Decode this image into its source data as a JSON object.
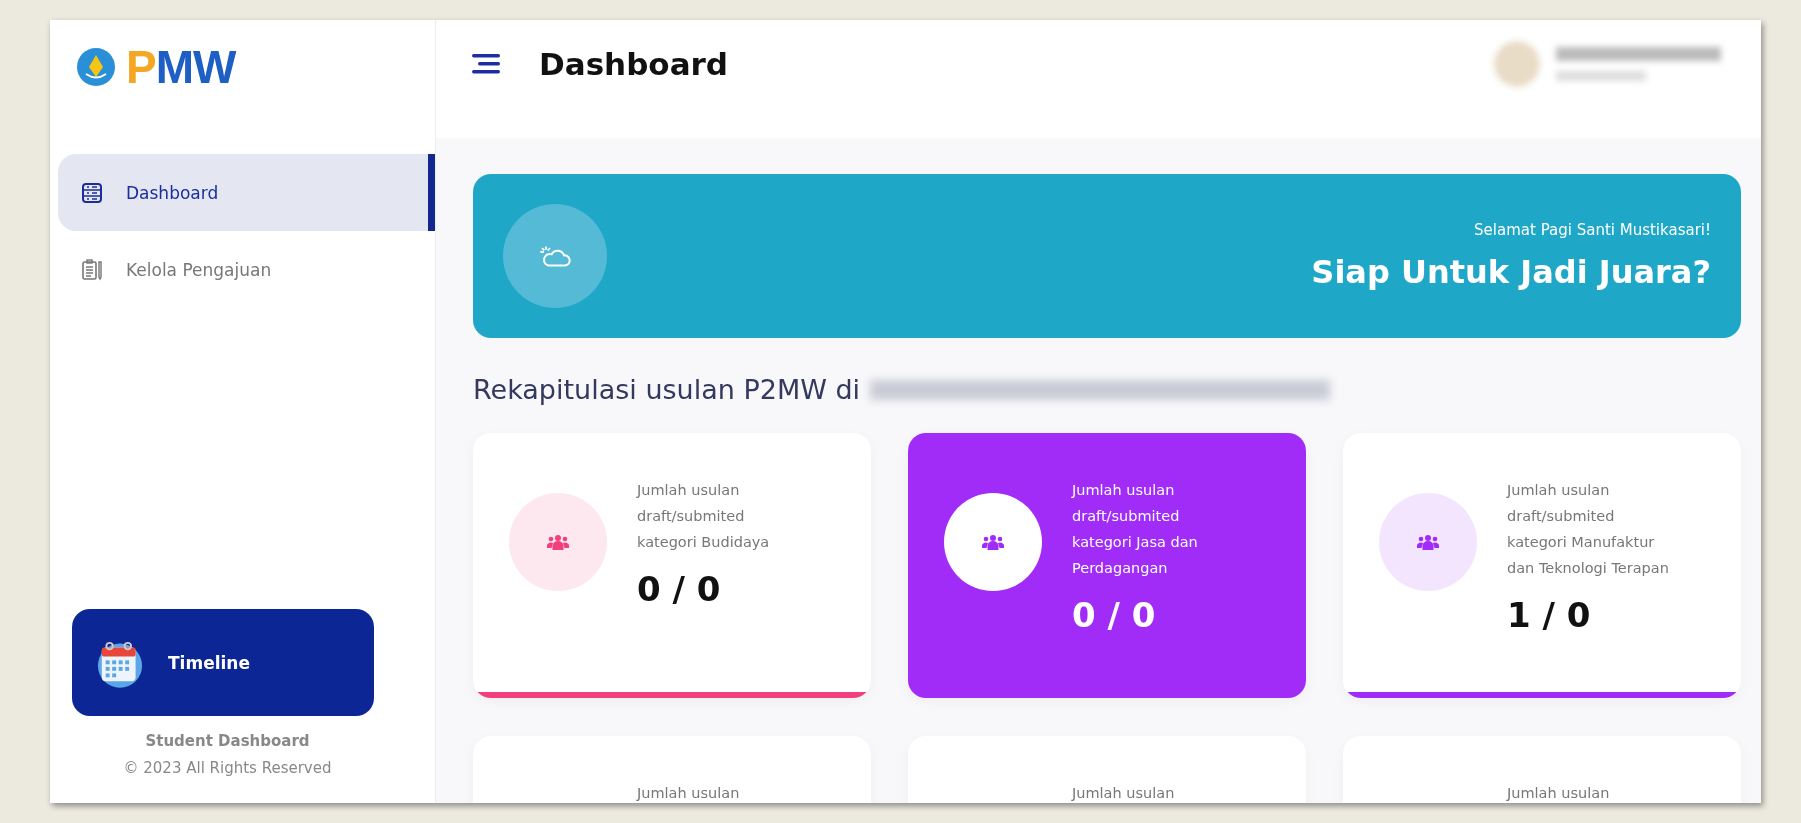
{
  "sidebar": {
    "brand": "PMW",
    "items": [
      {
        "label": "Dashboard",
        "selected": true
      },
      {
        "label": "Kelola Pengajuan",
        "selected": false
      }
    ],
    "timeline_button": "Timeline",
    "footer_title": "Student Dashboard",
    "footer_copyright": "© 2023 All Rights Reserved"
  },
  "header": {
    "title": "Dashboard"
  },
  "banner": {
    "greeting": "Selamat Pagi Santi Mustikasari!",
    "headline": "Siap Untuk Jadi Juara?"
  },
  "section_title": "Rekapitulasi usulan P2MW di",
  "cards": [
    {
      "label": "Jumlah usulan draft/submited kategori Budidaya",
      "count": "0 / 0",
      "color": "#f43f7f",
      "highlighted": false
    },
    {
      "label": "Jumlah usulan draft/submited kategori Jasa dan Perdagangan",
      "count": "0 / 0",
      "color": "#a12cf8",
      "highlighted": true
    },
    {
      "label": "Jumlah usulan draft/submited kategori Manufaktur dan Teknologi Terapan",
      "count": "1 / 0",
      "color": "#a12cf8",
      "highlighted": false
    },
    {
      "label": "Jumlah usulan",
      "highlighted": false
    },
    {
      "label": "Jumlah usulan",
      "highlighted": false
    },
    {
      "label": "Jumlah usulan",
      "highlighted": false
    }
  ]
}
